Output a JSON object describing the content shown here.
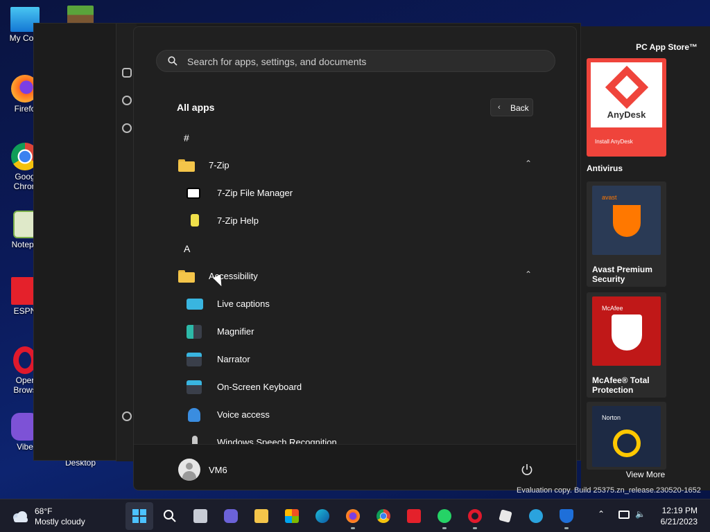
{
  "desktop": {
    "icons": [
      {
        "label": "My Com",
        "icon": "computer-icon"
      },
      {
        "label": "Firefo",
        "icon": "firefox-icon"
      },
      {
        "label": "Goog Chron",
        "icon": "chrome-icon"
      },
      {
        "label": "Notepa",
        "icon": "notepad-icon"
      },
      {
        "label": "ESPN",
        "icon": "espn-icon"
      },
      {
        "label": "Oper Brows",
        "icon": "opera-icon"
      },
      {
        "label": "Vibe",
        "icon": "viber-icon"
      },
      {
        "label": "Desktop",
        "icon": ""
      }
    ]
  },
  "start_menu": {
    "search_placeholder": "Search for apps, settings, and documents",
    "all_apps_label": "All apps",
    "back_label": "Back",
    "list": [
      {
        "kind": "letter",
        "text": "#"
      },
      {
        "kind": "folder",
        "text": "7-Zip"
      },
      {
        "kind": "app",
        "text": "7-Zip File Manager",
        "icon": "7zip-icon"
      },
      {
        "kind": "app",
        "text": "7-Zip Help",
        "icon": "help-icon"
      },
      {
        "kind": "letter",
        "text": "A"
      },
      {
        "kind": "folder",
        "text": "Accessibility"
      },
      {
        "kind": "app",
        "text": "Live captions",
        "icon": "live-captions-icon"
      },
      {
        "kind": "app",
        "text": "Magnifier",
        "icon": "magnifier-icon"
      },
      {
        "kind": "app",
        "text": "Narrator",
        "icon": "narrator-icon"
      },
      {
        "kind": "app",
        "text": "On-Screen Keyboard",
        "icon": "keyboard-icon"
      },
      {
        "kind": "app",
        "text": "Voice access",
        "icon": "voice-access-icon"
      },
      {
        "kind": "app",
        "text": "Windows Speech Recognition",
        "icon": "microphone-icon"
      }
    ],
    "user_name": "VM6"
  },
  "store": {
    "title": "PC App Store™",
    "anydesk_name": "AnyDesk",
    "anydesk_caption": "Install AnyDesk",
    "section_title": "Antivirus",
    "cards": [
      {
        "vendor": "avast",
        "title": "Avast Premium Security",
        "color": "#2a3a55"
      },
      {
        "vendor": "McAfee",
        "title": "McAfee® Total Protection",
        "color": "#c01818"
      },
      {
        "vendor": "Norton",
        "title": "",
        "color": "#1d2a44"
      }
    ],
    "view_more": "View More"
  },
  "watermark": "Evaluation copy. Build 25375.zn_release.230520-1652",
  "taskbar": {
    "weather_temp": "68°F",
    "weather_cond": "Mostly cloudy",
    "apps": [
      "start-icon",
      "search-icon",
      "task-view-icon",
      "teams-icon",
      "file-explorer-icon",
      "store-icon",
      "edge-icon",
      "firefox-icon",
      "chrome-icon",
      "espn-icon",
      "whatsapp-icon",
      "opera-icon",
      "roblox-icon",
      "telegram-icon",
      "defender-icon"
    ],
    "time": "12:19 PM",
    "date": "6/21/2023"
  },
  "colors": {
    "accent": "#f4c54a",
    "anydesk": "#ef443b",
    "taskbar": "#1b1d2a"
  }
}
